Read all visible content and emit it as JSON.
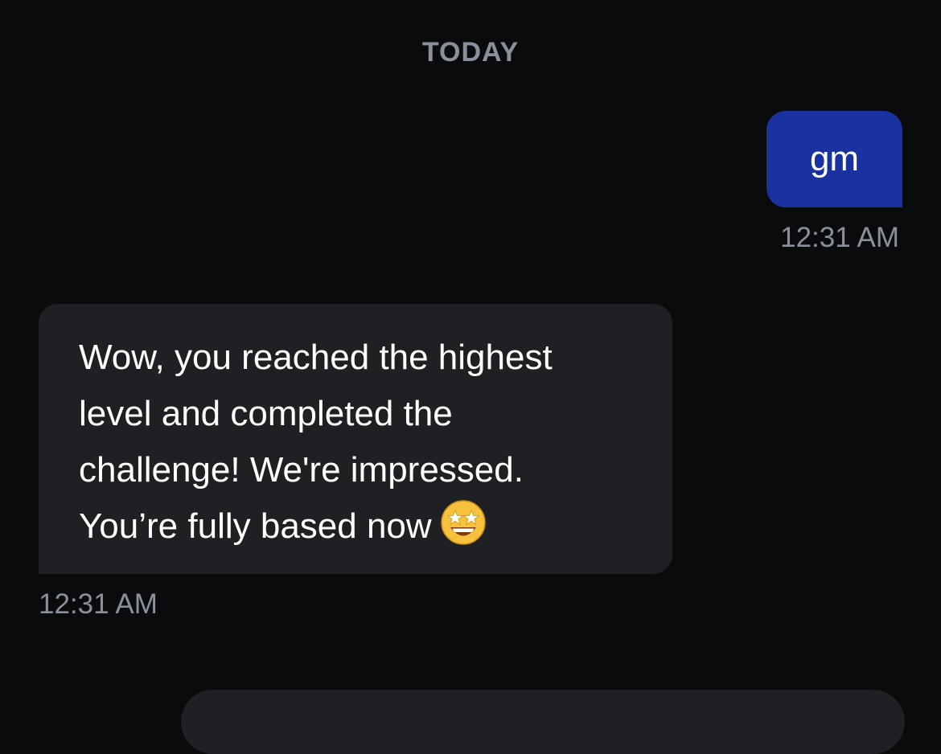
{
  "date_divider": "TODAY",
  "messages": [
    {
      "direction": "sent",
      "text": "gm",
      "time": "12:31 AM"
    },
    {
      "direction": "received",
      "text": "Wow, you reached the highest\nlevel and completed the\nchallenge! We're impressed.\nYou’re fully based now",
      "emoji": "star-struck-emoji",
      "time": "12:31 AM"
    }
  ],
  "colors": {
    "background": "#0a0b0d",
    "sent_bubble": "#1932a0",
    "received_bubble": "#1f2023",
    "muted_text": "#8a8f9c"
  }
}
